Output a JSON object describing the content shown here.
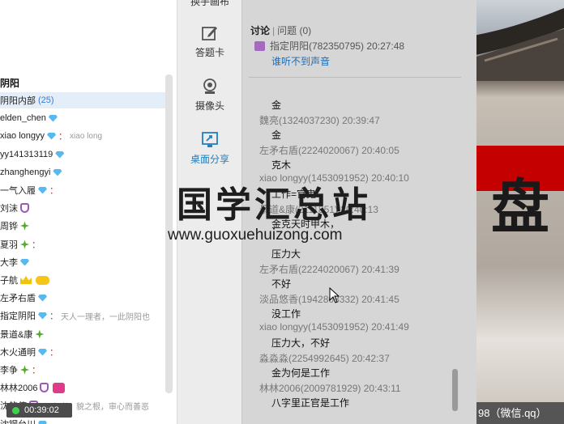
{
  "left": {
    "group_title": "阴阳",
    "members": [
      {
        "name": "阴阳内部",
        "count": "(25)",
        "badges": [],
        "colon": "",
        "sig": "",
        "selected": true
      },
      {
        "name": "elden_chen",
        "badges": [
          "gem"
        ],
        "colon": "",
        "sig": ""
      },
      {
        "name": "xiao longyy",
        "badges": [
          "gem"
        ],
        "colon": "：",
        "sig": "xiao long"
      },
      {
        "name": "yy141313119",
        "badges": [
          "gem"
        ],
        "colon": "",
        "sig": ""
      },
      {
        "name": "zhanghengyi",
        "badges": [
          "gem"
        ],
        "colon": "",
        "sig": ""
      },
      {
        "name": "一气入履",
        "badges": [
          "gem"
        ],
        "colon": "：",
        "sig": ""
      },
      {
        "name": "刘沫",
        "badges": [
          "shield"
        ],
        "colon": "",
        "sig": ""
      },
      {
        "name": "周铧",
        "badges": [
          "clover"
        ],
        "colon": "",
        "sig": ""
      },
      {
        "name": "夏羽",
        "badges": [
          "clover"
        ],
        "colon": "：",
        "sig": ""
      },
      {
        "name": "大李",
        "badges": [
          "gem"
        ],
        "colon": "",
        "sig": ""
      },
      {
        "name": "子航",
        "badges": [
          "crown",
          "gamepad"
        ],
        "colon": "",
        "sig": ""
      },
      {
        "name": "左矛右盾",
        "badges": [
          "gem"
        ],
        "colon": "",
        "sig": ""
      },
      {
        "name": "指定阴阳",
        "badges": [
          "gem"
        ],
        "colon": "：",
        "sig": "天人一理者，一此阴阳也"
      },
      {
        "name": "景道&康",
        "badges": [
          "clover"
        ],
        "colon": "",
        "sig": ""
      },
      {
        "name": "木火通明",
        "badges": [
          "gem"
        ],
        "colon": "：",
        "sig": ""
      },
      {
        "name": "李争",
        "badges": [
          "clover"
        ],
        "colon": "：",
        "sig": ""
      },
      {
        "name": "林林2006",
        "badges": [
          "shield",
          "heart"
        ],
        "colon": "",
        "sig": ""
      },
      {
        "name": "沈的使",
        "badges": [
          "shield"
        ],
        "colon": "：",
        "sig": "心者，貌之根，审心而善恶"
      },
      {
        "name": "沈钢台川",
        "badges": [
          "gem"
        ],
        "colon": "",
        "sig": ""
      }
    ],
    "timer": "00:39:02"
  },
  "tools": {
    "top_cut": "换手画布",
    "items": [
      {
        "label": "答题卡",
        "icon": "edit-icon"
      },
      {
        "label": "摄像头",
        "icon": "camera-icon"
      },
      {
        "label": "桌面分享",
        "icon": "screen-share-icon",
        "active": true
      }
    ]
  },
  "chat": {
    "tab_discuss": "讨论",
    "tab_sep": "|",
    "tab_question": "问题",
    "tab_question_count": "(0)",
    "notice_sender": "指定阴阳(782350795) 20:27:48",
    "notice_link": "谁听不到声音",
    "messages": [
      {
        "head": "",
        "body": "金"
      },
      {
        "head": "魏亮(1324037230) 20:39:47",
        "body": "金"
      },
      {
        "head": "左矛右盾(2224020067) 20:40:05",
        "body": "克木"
      },
      {
        "head": "xiao longyy(1453091952) 20:40:10",
        "body": "工作=官鬼"
      },
      {
        "head": "景道&康(2111851) 20:40:13",
        "body": "金克天时甲木，"
      },
      {
        "head": "",
        "body": "压力大"
      },
      {
        "head": "左矛右盾(2224020067) 20:41:39",
        "body": "不好"
      },
      {
        "head": "淡品悠香(1942803332) 20:41:45",
        "body": "没工作"
      },
      {
        "head": "xiao longyy(1453091952) 20:41:49",
        "body": "压力大，不好"
      },
      {
        "head": "淼淼淼(2254992645) 20:42:37",
        "body": "金为何是工作"
      },
      {
        "head": "林林2006(2009781929) 20:43:11",
        "body": "八字里正官是工作"
      }
    ]
  },
  "presentation": {
    "glyph": "盘",
    "wechat_text": "98（微信.qq）"
  },
  "watermark": {
    "cn": "国学汇总站",
    "url": "www.guoxuehuizong.com"
  },
  "colors": {
    "accent_blue": "#1d7fc4",
    "link_blue": "#1d6fb8",
    "banner_red": "#c50000",
    "chat_bg": "#d6d6d6"
  }
}
